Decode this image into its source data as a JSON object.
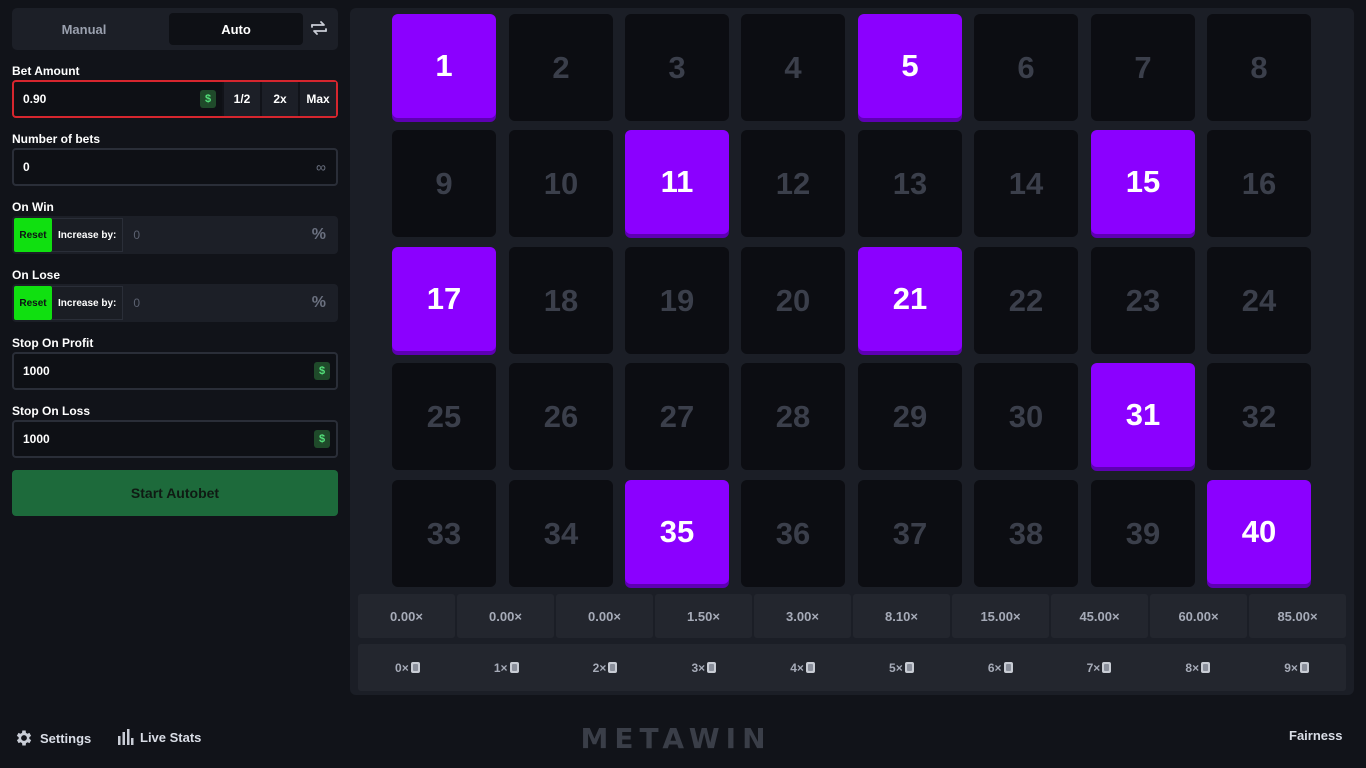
{
  "tabs": {
    "manual": "Manual",
    "auto": "Auto"
  },
  "bet_amount": {
    "label": "Bet Amount",
    "value": "0.90",
    "currency_icon": "$",
    "half": "1/2",
    "double": "2x",
    "max": "Max"
  },
  "number_of_bets": {
    "label": "Number of bets",
    "value": "0",
    "infinity_icon": "∞"
  },
  "on_win": {
    "label": "On Win",
    "reset": "Reset",
    "increase_label": "Increase by:",
    "value": "0",
    "unit": "%"
  },
  "on_lose": {
    "label": "On Lose",
    "reset": "Reset",
    "increase_label": "Increase by:",
    "value": "0",
    "unit": "%"
  },
  "stop_on_profit": {
    "label": "Stop On Profit",
    "value": "1000",
    "currency_icon": "$"
  },
  "stop_on_loss": {
    "label": "Stop On Loss",
    "value": "1000",
    "currency_icon": "$"
  },
  "start_button": "Start Autobet",
  "tiles": [
    {
      "n": "1",
      "sel": true
    },
    {
      "n": "2",
      "sel": false
    },
    {
      "n": "3",
      "sel": false
    },
    {
      "n": "4",
      "sel": false
    },
    {
      "n": "5",
      "sel": true
    },
    {
      "n": "6",
      "sel": false
    },
    {
      "n": "7",
      "sel": false
    },
    {
      "n": "8",
      "sel": false
    },
    {
      "n": "9",
      "sel": false
    },
    {
      "n": "10",
      "sel": false
    },
    {
      "n": "11",
      "sel": true
    },
    {
      "n": "12",
      "sel": false
    },
    {
      "n": "13",
      "sel": false
    },
    {
      "n": "14",
      "sel": false
    },
    {
      "n": "15",
      "sel": true
    },
    {
      "n": "16",
      "sel": false
    },
    {
      "n": "17",
      "sel": true
    },
    {
      "n": "18",
      "sel": false
    },
    {
      "n": "19",
      "sel": false
    },
    {
      "n": "20",
      "sel": false
    },
    {
      "n": "21",
      "sel": true
    },
    {
      "n": "22",
      "sel": false
    },
    {
      "n": "23",
      "sel": false
    },
    {
      "n": "24",
      "sel": false
    },
    {
      "n": "25",
      "sel": false
    },
    {
      "n": "26",
      "sel": false
    },
    {
      "n": "27",
      "sel": false
    },
    {
      "n": "28",
      "sel": false
    },
    {
      "n": "29",
      "sel": false
    },
    {
      "n": "30",
      "sel": false
    },
    {
      "n": "31",
      "sel": true
    },
    {
      "n": "32",
      "sel": false
    },
    {
      "n": "33",
      "sel": false
    },
    {
      "n": "34",
      "sel": false
    },
    {
      "n": "35",
      "sel": true
    },
    {
      "n": "36",
      "sel": false
    },
    {
      "n": "37",
      "sel": false
    },
    {
      "n": "38",
      "sel": false
    },
    {
      "n": "39",
      "sel": false
    },
    {
      "n": "40",
      "sel": true
    }
  ],
  "payouts": [
    "0.00×",
    "0.00×",
    "0.00×",
    "1.50×",
    "3.00×",
    "8.10×",
    "15.00×",
    "45.00×",
    "60.00×",
    "85.00×"
  ],
  "hits": [
    "0×",
    "1×",
    "2×",
    "3×",
    "4×",
    "5×",
    "6×",
    "7×",
    "8×",
    "9×"
  ],
  "footer": {
    "settings": "Settings",
    "live_stats": "Live Stats",
    "logo": "METAWIN",
    "fairness": "Fairness"
  },
  "colors": {
    "selected_tile": "#8b00ff",
    "reset_green": "#10e010",
    "start_green": "#1d6a3b",
    "error_border": "#d6262e"
  }
}
